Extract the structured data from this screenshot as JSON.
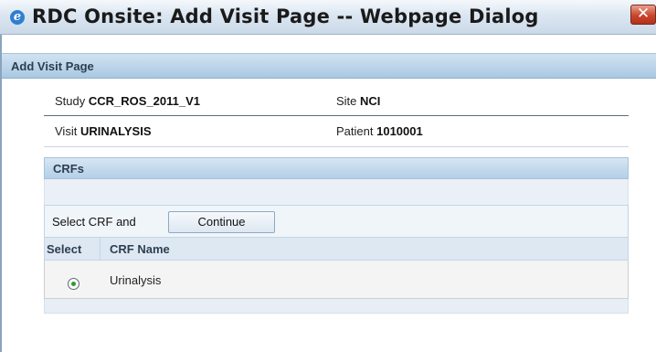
{
  "window": {
    "title": "RDC Onsite: Add Visit Page -- Webpage Dialog",
    "close_glyph": "✕",
    "app_icon": "ie-icon"
  },
  "page": {
    "title": "Add Visit Page"
  },
  "info": {
    "study_label": "Study",
    "study_value": "CCR_ROS_2011_V1",
    "site_label": "Site",
    "site_value": "NCI",
    "visit_label": "Visit",
    "visit_value": "URINALYSIS",
    "patient_label": "Patient",
    "patient_value": "1010001"
  },
  "crfs": {
    "header": "CRFs",
    "select_label": "Select CRF and",
    "continue_label": "Continue",
    "columns": [
      "Select",
      "CRF Name"
    ],
    "rows": [
      {
        "name": "Urinalysis",
        "selected": true
      }
    ]
  },
  "colors": {
    "header_blue": "#aac8e2",
    "radio_selected": "#2f9a2f",
    "close_red": "#c8452c"
  }
}
